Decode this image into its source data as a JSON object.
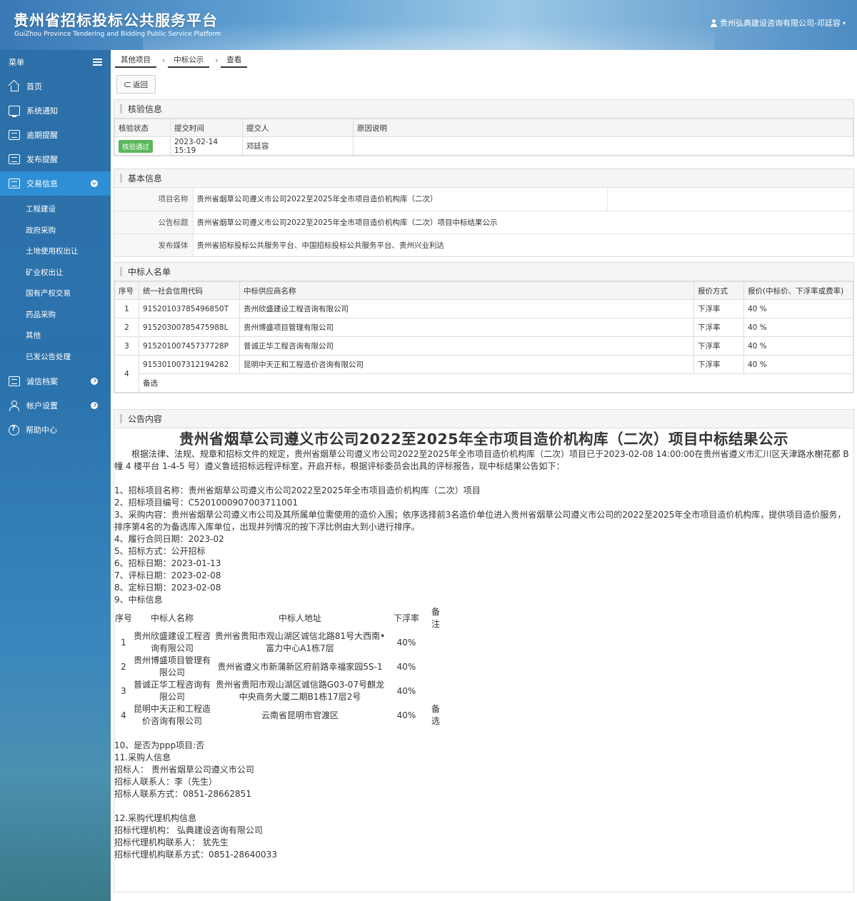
{
  "header": {
    "title": "贵州省招标投标公共服务平台",
    "subtitle": "GuiZhou Province Tendering and Bidding Public Service Platform",
    "user": "贵州弘典建设咨询有限公司-邓廷容"
  },
  "sidebar": {
    "menu_label": "菜单",
    "items": [
      {
        "label": "首页"
      },
      {
        "label": "系统通知"
      },
      {
        "label": "逾期提醒"
      },
      {
        "label": "发布提醒"
      },
      {
        "label": "交易信息"
      }
    ],
    "sub_items": [
      {
        "label": "工程建设"
      },
      {
        "label": "政府采购"
      },
      {
        "label": "土地使用权出让"
      },
      {
        "label": "矿业权出让"
      },
      {
        "label": "国有产权交易"
      },
      {
        "label": "药品采购"
      },
      {
        "label": "其他"
      },
      {
        "label": "已发公告处理"
      }
    ],
    "bottom_items": [
      {
        "label": "诚信档案"
      },
      {
        "label": "帐户设置"
      },
      {
        "label": "帮助中心"
      }
    ]
  },
  "breadcrumb": [
    "其他项目",
    "中标公示",
    "查看"
  ],
  "back_label": "返回",
  "verify": {
    "title": "核验信息",
    "headers": [
      "核验状态",
      "提交时间",
      "提交人",
      "原因说明"
    ],
    "status": "核验通过",
    "time": "2023-02-14 15:19",
    "submitter": "邓廷容",
    "reason": ""
  },
  "basic": {
    "title": "基本信息",
    "rows": [
      {
        "k": "项目名称",
        "v": "贵州省烟草公司遵义市公司2022至2025年全市项目造价机构库（二次）"
      },
      {
        "k": "公告标题",
        "v": "贵州省烟草公司遵义市公司2022至2025年全市项目造价机构库（二次）项目中标结果公示"
      },
      {
        "k": "发布媒体",
        "v": "贵州省招标投标公共服务平台、中国招标投标公共服务平台、贵州兴业利达"
      }
    ]
  },
  "winners": {
    "title": "中标人名单",
    "headers": [
      "序号",
      "统一社会信用代码",
      "中标供应商名称",
      "报价方式",
      "报价(中标价、下浮率或费率)"
    ],
    "rows": [
      {
        "no": "1",
        "code": "91520103785496850T",
        "name": "贵州欣盛建设工程咨询有限公司",
        "mode": "下浮率",
        "price": "40 %"
      },
      {
        "no": "2",
        "code": "91520300785475988L",
        "name": "贵州博盛项目管理有限公司",
        "mode": "下浮率",
        "price": "40 %"
      },
      {
        "no": "3",
        "code": "91520100745737728P",
        "name": "普诚正华工程咨询有限公司",
        "mode": "下浮率",
        "price": "40 %"
      },
      {
        "no": "4",
        "code": "915301007312194282",
        "name": "昆明中天正和工程造价咨询有限公司",
        "mode": "下浮率",
        "price": "40 %"
      }
    ],
    "remark": "备选"
  },
  "announcement": {
    "panel_title": "公告内容",
    "heading": "贵州省烟草公司遵义市公司2022至2025年全市项目造价机构库（二次）项目中标结果公示",
    "intro": "根据法律、法规、规章和招标文件的规定，贵州省烟草公司遵义市公司2022至2025年全市项目造价机构库（二次）项目已于2023-02-08 14:00:00在贵州省遵义市汇川区天津路水榭花都 B 幢 4 楼平台 1-4-5 号）遵义鲁班招标远程评标室，开启开标，根据评标委员会出具的评标报告，现中标结果公告如下：",
    "items": [
      "1、招标项目名称：贵州省烟草公司遵义市公司2022至2025年全市项目造价机构库（二次）项目",
      "2、招标项目编号：C5201000907003711001",
      "3、采购内容：贵州省烟草公司遵义市公司及其所属单位需使用的造价入围；依序选择前3名造价单位进入贵州省烟草公司遵义市公司的2022至2025年全市项目造价机构库，提供项目造价服务，排序第4名的为备选库入库单位，出现并列情况的按下浮比例由大到小进行排序。",
      "4、履行合同日期：2023-02",
      "5、招标方式：公开招标",
      "6、招标日期：2023-01-13",
      "7、评标日期：2023-02-08",
      "8、定标日期：2023-02-08",
      "9、中标信息"
    ],
    "table_headers": [
      "序号",
      "中标人名称",
      "中标人地址",
      "下浮率",
      "备注"
    ],
    "table_rows": [
      {
        "no": "1",
        "name": "贵州欣盛建设工程咨询有限公司",
        "addr": "贵州省贵阳市观山湖区诚信北路81号大西南•富力中心A1栋7层",
        "rate": "40%",
        "note": ""
      },
      {
        "no": "2",
        "name": "贵州博盛项目管理有限公司",
        "addr": "贵州省遵义市新蒲新区府前路幸福家园5S-1",
        "rate": "40%",
        "note": ""
      },
      {
        "no": "3",
        "name": "普诚正华工程咨询有限公司",
        "addr": "贵州省贵阳市观山湖区诚信路G03-07号麒龙中央商务大厦二期B1栋17层2号",
        "rate": "40%",
        "note": ""
      },
      {
        "no": "4",
        "name": "昆明中天正和工程造价咨询有限公司",
        "addr": "云南省昆明市官渡区",
        "rate": "40%",
        "note": "备选"
      }
    ],
    "after": [
      "10、是否为ppp项目:否",
      "11.采购人信息",
      "招标人： 贵州省烟草公司遵义市公司",
      "招标人联系人：李（先生）",
      "招标人联系方式：0851-28662851"
    ],
    "agency": [
      "12.采购代理机构信息",
      "招标代理机构： 弘典建设咨询有限公司",
      "招标代理机构联系人： 犹先生",
      "招标代理机构联系方式：0851-28640033"
    ]
  }
}
